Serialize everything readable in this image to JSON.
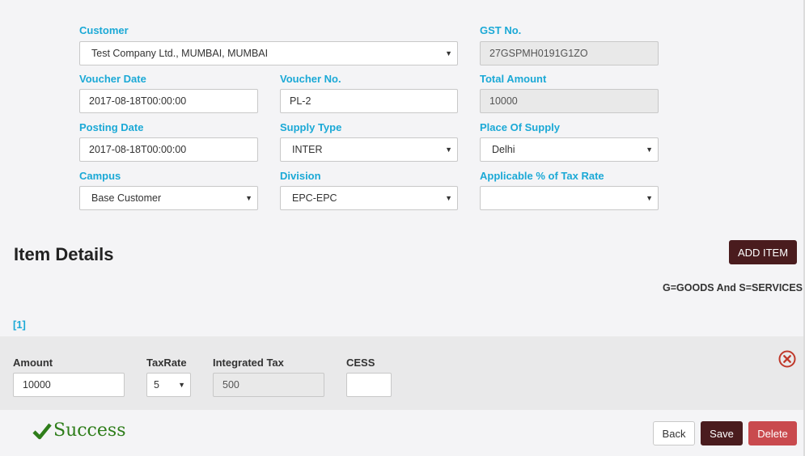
{
  "form": {
    "customer": {
      "label": "Customer",
      "value": "Test Company Ltd., MUMBAI, MUMBAI"
    },
    "gst_no": {
      "label": "GST No.",
      "value": "27GSPMH0191G1ZO"
    },
    "voucher_date": {
      "label": "Voucher Date",
      "value": "2017-08-18T00:00:00"
    },
    "voucher_no": {
      "label": "Voucher No.",
      "value": "PL-2"
    },
    "total_amount": {
      "label": "Total Amount",
      "value": "10000"
    },
    "posting_date": {
      "label": "Posting Date",
      "value": "2017-08-18T00:00:00"
    },
    "supply_type": {
      "label": "Supply Type",
      "value": "INTER"
    },
    "place_of_supply": {
      "label": "Place Of Supply",
      "value": "Delhi"
    },
    "campus": {
      "label": "Campus",
      "value": "Base Customer"
    },
    "division": {
      "label": "Division",
      "value": "EPC-EPC"
    },
    "tax_rate_pct": {
      "label": "Applicable % of Tax Rate",
      "value": ""
    }
  },
  "item_details": {
    "title": "Item Details",
    "add_button": "ADD ITEM",
    "note": "G=GOODS And S=SERVICES",
    "items": [
      {
        "index": "[1]",
        "amount": {
          "label": "Amount",
          "value": "10000"
        },
        "tax_rate": {
          "label": "TaxRate",
          "value": "5"
        },
        "integrated_tax": {
          "label": "Integrated Tax",
          "value": "500"
        },
        "cess": {
          "label": "CESS",
          "value": ""
        }
      }
    ]
  },
  "status": {
    "text": "Success",
    "icon": "check-icon"
  },
  "actions": {
    "back": "Back",
    "save": "Save",
    "delete": "Delete"
  },
  "colors": {
    "label_blue": "#1ba9d6",
    "dark_button": "#4a1c1e",
    "delete_red": "#c94a4e",
    "success_green": "#2e7d1a",
    "remove_red": "#c0392b"
  }
}
